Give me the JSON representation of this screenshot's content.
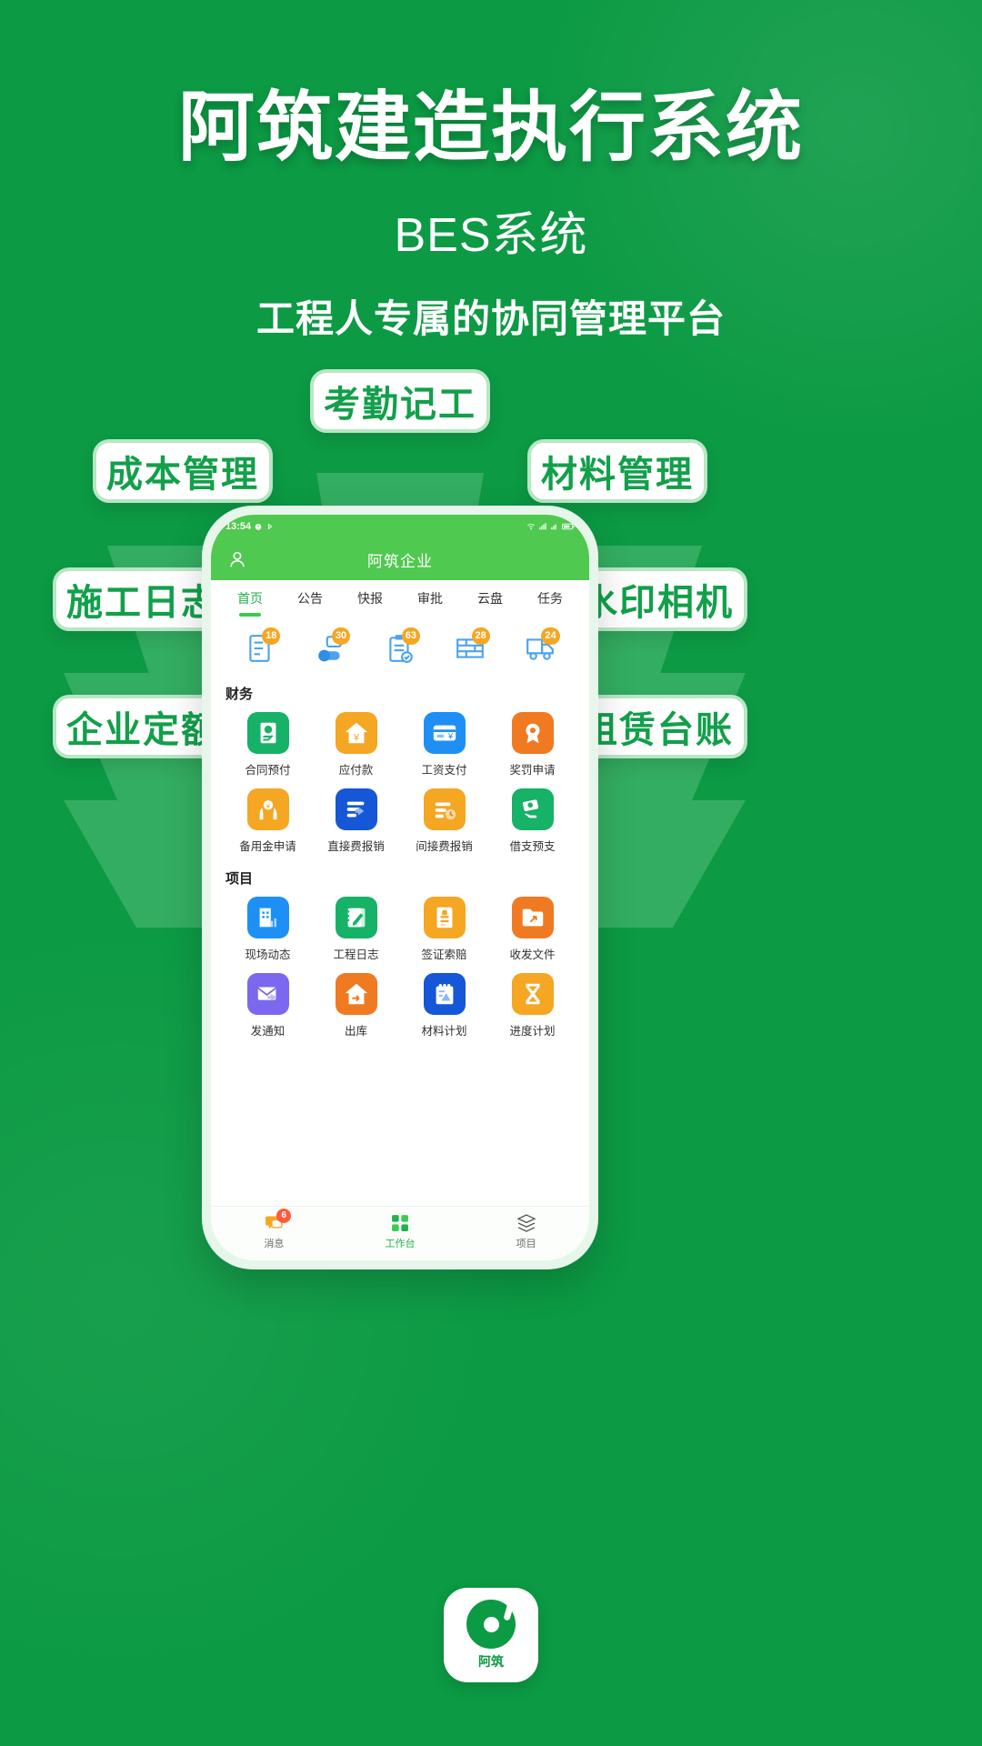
{
  "hero": {
    "title": "阿筑建造执行系统",
    "subtitle": "BES系统",
    "tagline": "工程人专属的协同管理平台"
  },
  "colors": {
    "brand_green": "#0C9A44",
    "accent_green": "#22B14C",
    "header_green": "#4FC94F",
    "badge_orange": "#F5A623",
    "badge_red": "#FF5A3C",
    "tile_blue": "#1E90F5",
    "tile_orange": "#F5A623",
    "tile_green": "#16B268",
    "tile_purple": "#7B68EE",
    "tile_deep_blue": "#1557D6",
    "tile_deep_orange": "#F07A22"
  },
  "feature_pills": [
    {
      "id": "kaoqin",
      "label": "考勤记工"
    },
    {
      "id": "cost",
      "label": "成本管理"
    },
    {
      "id": "material",
      "label": "材料管理"
    },
    {
      "id": "log",
      "label": "施工日志"
    },
    {
      "id": "camera",
      "label": "水印相机"
    },
    {
      "id": "quota",
      "label": "企业定额"
    },
    {
      "id": "lease",
      "label": "租赁台账"
    }
  ],
  "phone": {
    "statusbar": {
      "time": "13:54",
      "left_icons": [
        "alarm-icon",
        "bluetooth-icon"
      ],
      "right_icons": [
        "wifi-icon",
        "signal-icon",
        "signal2-icon",
        "battery-icon"
      ]
    },
    "app_header": {
      "title": "阿筑企业",
      "avatar": "user-avatar-icon"
    },
    "tabs": [
      {
        "label": "首页",
        "active": true
      },
      {
        "label": "公告",
        "active": false
      },
      {
        "label": "快报",
        "active": false
      },
      {
        "label": "审批",
        "active": false
      },
      {
        "label": "云盘",
        "active": false
      },
      {
        "label": "任务",
        "active": false
      }
    ],
    "shortcuts": [
      {
        "icon": "document-list-icon",
        "badge": "18"
      },
      {
        "icon": "progress-person-icon",
        "badge": "30"
      },
      {
        "icon": "clipboard-check-icon",
        "badge": "63"
      },
      {
        "icon": "brick-wall-icon",
        "badge": "28"
      },
      {
        "icon": "truck-icon",
        "badge": "24"
      }
    ],
    "sections": [
      {
        "title": "财务",
        "items": [
          {
            "label": "合同预付",
            "icon": "contract-seal-icon",
            "color": "#16B268"
          },
          {
            "label": "应付款",
            "icon": "house-yuan-icon",
            "color": "#F5A623"
          },
          {
            "label": "工资支付",
            "icon": "bank-card-yuan-icon",
            "color": "#1E90F5"
          },
          {
            "label": "奖罚申请",
            "icon": "medal-award-icon",
            "color": "#F07A22"
          },
          {
            "label": "备用金申请",
            "icon": "hands-coin-icon",
            "color": "#F5A623"
          },
          {
            "label": "直接费报销",
            "icon": "list-arrow-icon",
            "color": "#1557D6"
          },
          {
            "label": "间接费报销",
            "icon": "list-clock-icon",
            "color": "#F5A623"
          },
          {
            "label": "借支预支",
            "icon": "cash-hand-icon",
            "color": "#16B268"
          }
        ]
      },
      {
        "title": "项目",
        "items": [
          {
            "label": "现场动态",
            "icon": "building-chart-icon",
            "color": "#1E90F5"
          },
          {
            "label": "工程日志",
            "icon": "notebook-pen-icon",
            "color": "#16B268"
          },
          {
            "label": "签证索赔",
            "icon": "stamp-card-icon",
            "color": "#F5A623"
          },
          {
            "label": "收发文件",
            "icon": "folder-share-icon",
            "color": "#F07A22"
          },
          {
            "label": "发通知",
            "icon": "mail-send-icon",
            "color": "#7B68EE"
          },
          {
            "label": "出库",
            "icon": "house-out-icon",
            "color": "#F07A22"
          },
          {
            "label": "材料计划",
            "icon": "plan-note-icon",
            "color": "#1557D6"
          },
          {
            "label": "进度计划",
            "icon": "hourglass-icon",
            "color": "#F5A623"
          }
        ]
      }
    ],
    "bottom_nav": [
      {
        "label": "消息",
        "icon": "message-icon",
        "badge": "6",
        "active": false
      },
      {
        "label": "工作台",
        "icon": "workbench-icon",
        "badge": "",
        "active": true
      },
      {
        "label": "项目",
        "icon": "layers-icon",
        "badge": "",
        "active": false
      }
    ]
  },
  "footer": {
    "logo_text": "阿筑",
    "logo_mark": "azhu-logo-icon"
  }
}
